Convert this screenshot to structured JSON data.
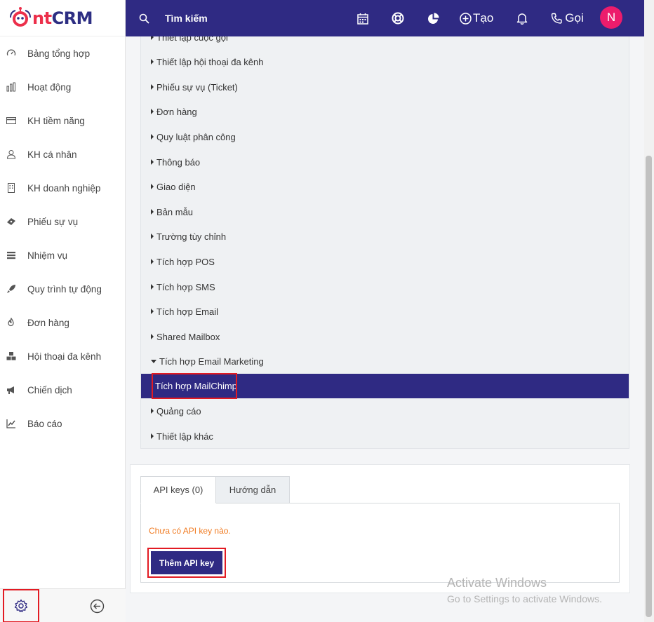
{
  "brand": {
    "logo_text_part1": "ntCRM"
  },
  "sidebar": {
    "items": [
      {
        "label": "Bảng tổng hợp",
        "icon": "gauge-icon"
      },
      {
        "label": "Hoạt động",
        "icon": "bar-chart-icon"
      },
      {
        "label": "KH tiềm năng",
        "icon": "card-icon"
      },
      {
        "label": "KH cá nhân",
        "icon": "user-icon"
      },
      {
        "label": "KH doanh nghiệp",
        "icon": "building-icon"
      },
      {
        "label": "Phiếu sự vụ",
        "icon": "ticket-icon"
      },
      {
        "label": "Nhiệm vụ",
        "icon": "tasks-icon"
      },
      {
        "label": "Quy trình tự động",
        "icon": "rocket-icon"
      },
      {
        "label": "Đơn hàng",
        "icon": "flame-icon"
      },
      {
        "label": "Hội thoại đa kênh",
        "icon": "cubes-icon"
      },
      {
        "label": "Chiến dịch",
        "icon": "megaphone-icon"
      },
      {
        "label": "Báo cáo",
        "icon": "line-chart-icon"
      }
    ]
  },
  "header": {
    "search_label": "Tìm kiếm",
    "create_label": "Tạo",
    "call_label": "Gọi",
    "avatar_initial": "N"
  },
  "settings_menu": {
    "items": [
      {
        "label": "Thiết lập cuộc gọi"
      },
      {
        "label": "Thiết lập hội thoại đa kênh"
      },
      {
        "label": "Phiếu sự vụ (Ticket)"
      },
      {
        "label": "Đơn hàng"
      },
      {
        "label": "Quy luật phân công"
      },
      {
        "label": "Thông báo"
      },
      {
        "label": "Giao diện"
      },
      {
        "label": "Bản mẫu"
      },
      {
        "label": "Trường tùy chỉnh"
      },
      {
        "label": "Tích hợp POS"
      },
      {
        "label": "Tích hợp SMS"
      },
      {
        "label": "Tích hợp Email"
      },
      {
        "label": "Shared Mailbox"
      },
      {
        "label": "Tích hợp Email Marketing"
      },
      {
        "label": "Tích hợp MailChimp"
      },
      {
        "label": "Quảng cáo"
      },
      {
        "label": "Thiết lập khác"
      }
    ]
  },
  "content": {
    "tabs": [
      {
        "label": "API keys (0)"
      },
      {
        "label": "Hướng dẫn"
      }
    ],
    "empty_message": "Chưa có API key nào.",
    "add_button_label": "Thêm API key"
  },
  "watermark": {
    "line1": "Activate Windows",
    "line2": "Go to Settings to activate Windows."
  },
  "colors": {
    "primary": "#2f2a83",
    "brand_red": "#ec2f4b",
    "avatar": "#ec1c6c",
    "warning_text": "#f07b22",
    "highlight_box": "#e21b23"
  }
}
